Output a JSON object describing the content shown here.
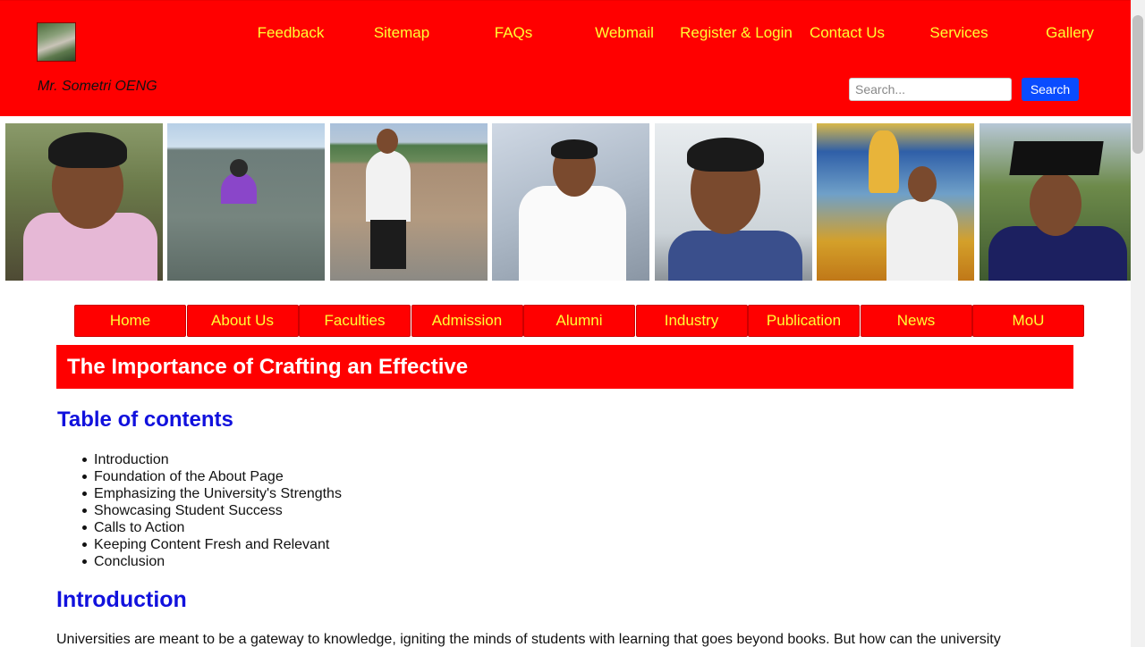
{
  "header": {
    "owner_name": "Mr. Sometri OENG",
    "top_links": [
      "Feedback",
      "Sitemap",
      "FAQs",
      "Webmail",
      "Register & Login",
      "Contact Us",
      "Services",
      "Gallery"
    ],
    "search": {
      "placeholder": "Search...",
      "button_label": "Search"
    }
  },
  "main_nav": [
    "Home",
    "About Us",
    "Faculties",
    "Admission",
    "Alumni",
    "Industry",
    "Publication",
    "News",
    "MoU"
  ],
  "article": {
    "title": "The Importance of Crafting an Effective",
    "toc_heading": "Table of contents",
    "toc_items": [
      "Introduction",
      "Foundation of the About Page",
      "Emphasizing the University's Strengths",
      "Showcasing Student Success",
      "Calls to Action",
      "Keeping Content Fresh and Relevant",
      "Conclusion"
    ],
    "intro_heading": "Introduction",
    "intro_text": "Universities are meant to be a gateway to knowledge, igniting the minds of students with learning that goes beyond books. But how can the university"
  },
  "colors": {
    "brand_red": "#ff0000",
    "nav_text": "#ffff33",
    "heading_blue": "#1111dd",
    "search_button": "#0a4cff"
  }
}
